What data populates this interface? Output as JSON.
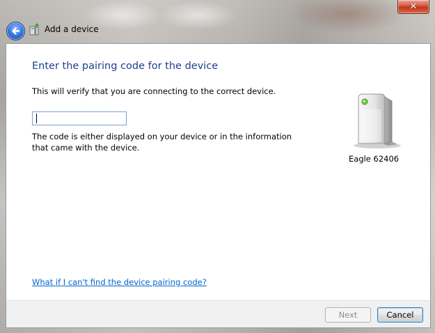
{
  "window": {
    "title": "Add a device",
    "close_glyph": "✕",
    "back_icon": "back-arrow-icon"
  },
  "page": {
    "heading": "Enter the pairing code for the device",
    "instruction": "This will verify that you are connecting to the correct device.",
    "code_input": {
      "value": "",
      "placeholder": ""
    },
    "help_text": "The code is either displayed on your device or in the information that came with the device.",
    "help_link": "What if I can't find the device pairing code?"
  },
  "device": {
    "name": "Eagle 62406",
    "icon": "device-tower-icon"
  },
  "footer": {
    "next_label": "Next",
    "cancel_label": "Cancel"
  },
  "colors": {
    "heading": "#1e3f8c",
    "link": "#0066cc",
    "close_button": "#c2351a",
    "back_button": "#2f6fd6"
  }
}
